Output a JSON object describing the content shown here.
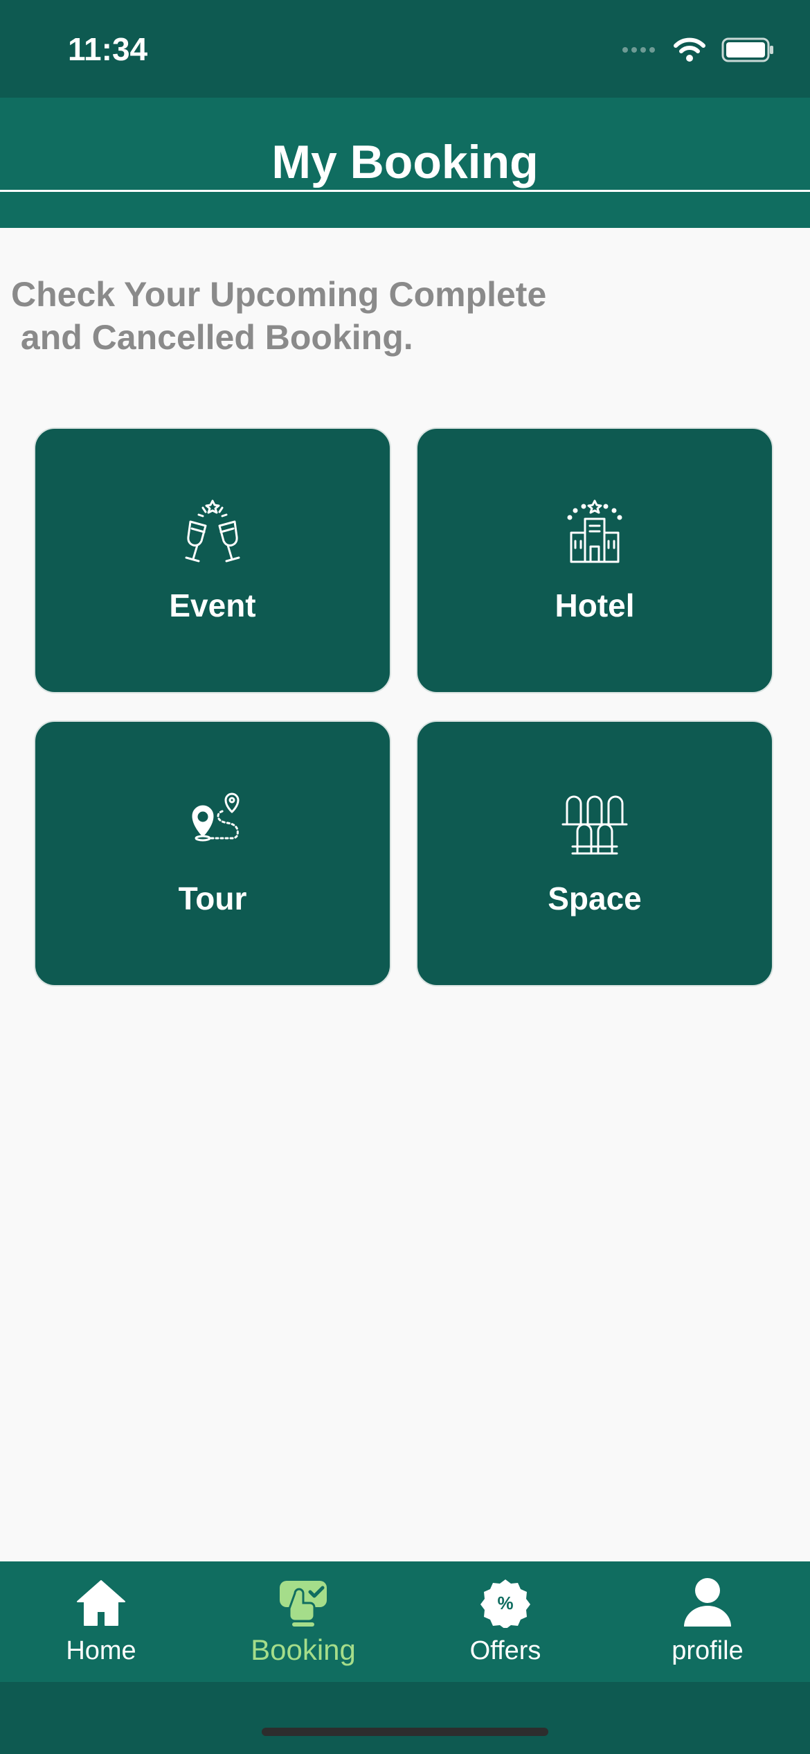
{
  "status_bar": {
    "time": "11:34"
  },
  "header": {
    "title": "My Booking"
  },
  "subtitle": {
    "line1": "Check Your Upcoming Complete",
    "line2": " and Cancelled Booking."
  },
  "categories": [
    {
      "label": "Event",
      "icon": "champagne-toast-icon"
    },
    {
      "label": "Hotel",
      "icon": "hotel-building-icon"
    },
    {
      "label": "Tour",
      "icon": "map-route-pin-icon"
    },
    {
      "label": "Space",
      "icon": "seats-icon"
    }
  ],
  "bottom_nav": {
    "active": "Booking",
    "items": [
      {
        "label": "Home",
        "icon": "home-icon"
      },
      {
        "label": "Booking",
        "icon": "booking-hand-icon"
      },
      {
        "label": "Offers",
        "icon": "discount-badge-icon"
      },
      {
        "label": "profile",
        "icon": "person-icon"
      }
    ]
  },
  "colors": {
    "header_dark": "#0e5a51",
    "header": "#106d60",
    "active_nav": "#a5dd8a",
    "subtitle_text": "#8a8a8a",
    "background": "#f9f9f9"
  }
}
